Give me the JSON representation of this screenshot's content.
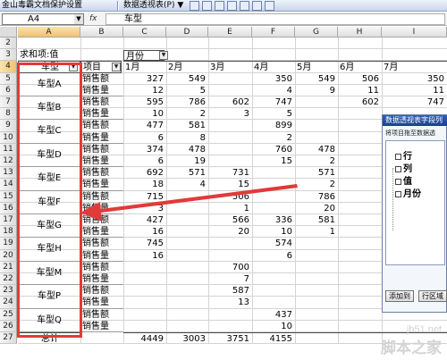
{
  "toolbar": {
    "protect_label": "金山毒霸文档保护设置",
    "pivot_menu": "数据透视表(P)",
    "pivot_menu_arrow": "▼"
  },
  "formula_bar": {
    "name_box": "A4",
    "fx": "fx",
    "value": "车型"
  },
  "columns": [
    "A",
    "B",
    "C",
    "D",
    "E",
    "F",
    "G",
    "H",
    "I"
  ],
  "rows": [
    "2",
    "3",
    "4",
    "5",
    "6",
    "7",
    "8",
    "9",
    "10",
    "11",
    "12",
    "13",
    "14",
    "15",
    "16",
    "17",
    "18",
    "19",
    "20",
    "21",
    "22",
    "23",
    "24",
    "25",
    "26",
    "27"
  ],
  "pivot": {
    "summary_label": "求和项:值",
    "month_field": "月份",
    "row_field": "车型",
    "item_field": "项目",
    "months": [
      "1月",
      "2月",
      "3月",
      "4月",
      "5月",
      "6月",
      "7月"
    ],
    "sales_label": "销售额",
    "qty_label": "销售量",
    "total_label": "总计",
    "groups": [
      {
        "name": "车型A",
        "sales": [
          "327",
          "549",
          "",
          "350",
          "549",
          "506",
          "350"
        ],
        "qty": [
          "12",
          "5",
          "",
          "4",
          "9",
          "11",
          "11"
        ]
      },
      {
        "name": "车型B",
        "sales": [
          "595",
          "786",
          "602",
          "747",
          "",
          "602",
          "747"
        ],
        "qty": [
          "10",
          "2",
          "3",
          "5",
          "",
          "",
          ""
        ]
      },
      {
        "name": "车型C",
        "sales": [
          "477",
          "581",
          "",
          "899",
          "",
          "",
          ""
        ],
        "qty": [
          "6",
          "8",
          "",
          "2",
          "",
          "",
          ""
        ]
      },
      {
        "name": "车型D",
        "sales": [
          "374",
          "478",
          "",
          "760",
          "478",
          "",
          ""
        ],
        "qty": [
          "6",
          "19",
          "",
          "15",
          "2",
          "",
          ""
        ]
      },
      {
        "name": "车型E",
        "sales": [
          "692",
          "571",
          "731",
          "",
          "571",
          "",
          ""
        ],
        "qty": [
          "18",
          "4",
          "15",
          "",
          "2",
          "",
          ""
        ]
      },
      {
        "name": "车型F",
        "sales": [
          "715",
          "",
          "506",
          "",
          "786",
          "",
          ""
        ],
        "qty": [
          "3",
          "",
          "1",
          "",
          "20",
          "",
          ""
        ]
      },
      {
        "name": "车型G",
        "sales": [
          "427",
          "",
          "566",
          "336",
          "581",
          "",
          ""
        ],
        "qty": [
          "16",
          "",
          "20",
          "10",
          "1",
          "",
          ""
        ]
      },
      {
        "name": "车型H",
        "sales": [
          "745",
          "",
          "",
          "574",
          "",
          "",
          ""
        ],
        "qty": [
          "16",
          "",
          "",
          "6",
          "",
          "",
          ""
        ]
      },
      {
        "name": "车型M",
        "sales": [
          "",
          "",
          "700",
          "",
          "",
          "",
          ""
        ],
        "qty": [
          "",
          "",
          "7",
          "",
          "",
          "",
          ""
        ]
      },
      {
        "name": "车型P",
        "sales": [
          "",
          "",
          "587",
          "",
          "",
          "",
          ""
        ],
        "qty": [
          "",
          "",
          "13",
          "",
          "",
          "",
          ""
        ]
      },
      {
        "name": "车型Q",
        "sales": [
          "",
          "",
          "",
          "437",
          "",
          "",
          ""
        ],
        "qty": [
          "",
          "",
          "",
          "10",
          "",
          "",
          ""
        ]
      }
    ],
    "totals": [
      "4449",
      "3003",
      "3751",
      "4155",
      "",
      "",
      ""
    ]
  },
  "field_panel": {
    "title": "数据透视表字段列",
    "hint": "将项目拖至数据透",
    "fields": [
      "行",
      "列",
      "值",
      "月份"
    ],
    "add_button": "添加到",
    "area_button": "行区域"
  },
  "watermark": {
    "site": "jb51.net",
    "brand": "脚本之家"
  },
  "colors": {
    "highlight_frame": "#e13a3a",
    "panel_title": "#1c3f8e"
  }
}
